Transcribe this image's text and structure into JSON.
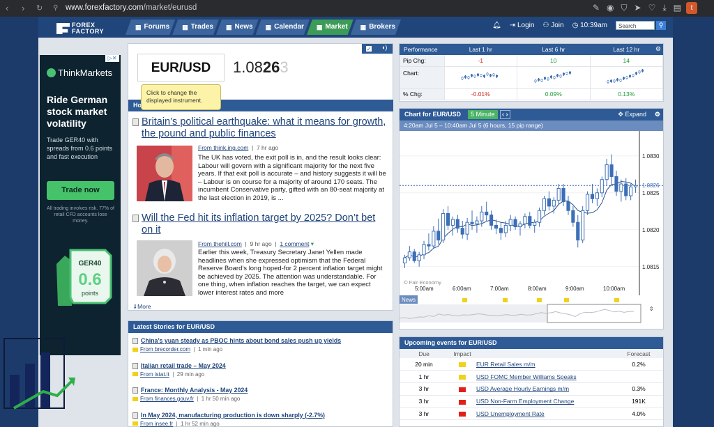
{
  "browser": {
    "url_host": "www.forexfactory.com",
    "url_path": "/market/eurusd",
    "profile_initial": "t"
  },
  "nav": {
    "logo_line1": "FOREX",
    "logo_line2": "FACTORY",
    "tabs": [
      {
        "label": "Forums",
        "icon": "forums-icon"
      },
      {
        "label": "Trades",
        "icon": "trades-icon"
      },
      {
        "label": "News",
        "icon": "news-icon"
      },
      {
        "label": "Calendar",
        "icon": "calendar-icon"
      },
      {
        "label": "Market",
        "icon": "market-icon",
        "active": true
      },
      {
        "label": "Brokers",
        "icon": "brokers-icon"
      }
    ],
    "login": "Login",
    "join": "Join",
    "time": "10:39am",
    "search_placeholder": "Search"
  },
  "ad": {
    "brand": "ThinkMarkets",
    "headline": "Ride German stock market volatility",
    "body": "Trade GER40 with spreads from 0.6 points and fast execution",
    "cta": "Trade now",
    "disclaimer": "All trading involves risk. 77% of retail CFD accounts lose money.",
    "promo_symbol": "GER40",
    "promo_value": "0.6",
    "promo_unit": "points"
  },
  "quote": {
    "pair": "EUR/USD",
    "price_main": "1.08",
    "price_big": "26",
    "price_small": "3",
    "tooltip": "Click to change the displayed instrument."
  },
  "hot_header": "Hottest Stories",
  "stories": [
    {
      "title": "Britain’s political earthquake: what it means for growth, the pound and public finances",
      "source": "From think.ing.com",
      "age": "7 hr ago",
      "body": "The UK has voted, the exit poll is in, and the result looks clear: Labour will govern with a significant majority for the next five years. If that exit poll is accurate – and history suggests it will be – Labour is on course for a majority of around 170 seats. The incumbent Conservative party, gifted with an 80-seat majority at the last election in 2019, is ..."
    },
    {
      "title": "Will the Fed hit its inflation target by 2025? Don’t bet on it",
      "source": "From thehill.com",
      "age": "9 hr ago",
      "comments": "1 comment",
      "body": "Earlier this week, Treasury Secretary Janet Yellen made headlines when she expressed optimism that the Federal Reserve Board’s long hoped-for 2 percent inflation target might be achieved by 2025. The attention was understandable. For one thing, when inflation reaches the target, we can expect lower interest rates and more"
    }
  ],
  "more": "More",
  "latest": {
    "header": "Latest Stories for EUR/USD",
    "items": [
      {
        "title": "China’s yuan steady as PBOC hints about bond sales push up yields",
        "source": "From brecorder.com",
        "age": "1 min ago"
      },
      {
        "title": "Italian retail trade – May 2024",
        "source": "From istat.it",
        "age": "29 min ago"
      },
      {
        "title": "France: Monthly Analysis - May 2024",
        "source": "From finances.gouv.fr",
        "age": "1 hr 50 min ago"
      },
      {
        "title": "In May 2024, manufacturing production is down sharply (-2.7%)",
        "source": "From insee.fr",
        "age": "1 hr 52 min ago"
      }
    ]
  },
  "performance": {
    "header": "Performance",
    "cols": [
      "Last 1 hr",
      "Last 6 hr",
      "Last 12 hr"
    ],
    "row_pip": "Pip Chg:",
    "row_chart": "Chart:",
    "row_pct": "% Chg:",
    "pips": [
      "-1",
      "10",
      "14"
    ],
    "pct": [
      "-0.01%",
      "0.09%",
      "0.13%"
    ],
    "colors": [
      "#c7271f",
      "#1f9b3b",
      "#1f9b3b"
    ]
  },
  "chart": {
    "header": "Chart for EUR/USD",
    "timeframe": "5 Minute",
    "expand": "Expand",
    "subtitle": "4:20am Jul 5 – 10:40am Jul 5 (6 hours, 15 pip range)",
    "source": "© Fair Economy",
    "news_label": "News",
    "current_price": "1.0826"
  },
  "chart_data": {
    "type": "candlestick",
    "x_labels": [
      "5:00am",
      "6:00am",
      "7:00am",
      "8:00am",
      "9:00am",
      "10:00am"
    ],
    "y_ticks": [
      "1.0830",
      "1.0825",
      "1.0820",
      "1.0815"
    ],
    "ylim": [
      1.0813,
      1.0833
    ],
    "ohlc": [
      [
        1.08155,
        1.08166,
        1.08148,
        1.08162
      ],
      [
        1.08162,
        1.08178,
        1.08158,
        1.0817
      ],
      [
        1.0817,
        1.08174,
        1.08155,
        1.08158
      ],
      [
        1.08158,
        1.0817,
        1.0815,
        1.08166
      ],
      [
        1.08166,
        1.08185,
        1.0816,
        1.0818
      ],
      [
        1.0818,
        1.08195,
        1.08172,
        1.08178
      ],
      [
        1.08178,
        1.08205,
        1.08174,
        1.08198
      ],
      [
        1.08198,
        1.08215,
        1.0818,
        1.08186
      ],
      [
        1.08186,
        1.08228,
        1.08182,
        1.08222
      ],
      [
        1.08222,
        1.08232,
        1.082,
        1.08206
      ],
      [
        1.08206,
        1.08218,
        1.08192,
        1.08214
      ],
      [
        1.08214,
        1.0822,
        1.08196,
        1.08202
      ],
      [
        1.08202,
        1.08212,
        1.08188,
        1.08194
      ],
      [
        1.08194,
        1.08216,
        1.08186,
        1.0821
      ],
      [
        1.0821,
        1.08226,
        1.082,
        1.08208
      ],
      [
        1.08208,
        1.08218,
        1.08196,
        1.08212
      ],
      [
        1.08212,
        1.08232,
        1.08204,
        1.08224
      ],
      [
        1.08224,
        1.08238,
        1.08212,
        1.0822
      ],
      [
        1.0822,
        1.08226,
        1.082,
        1.08206
      ],
      [
        1.08206,
        1.08214,
        1.08194,
        1.08202
      ],
      [
        1.08202,
        1.0821,
        1.08186,
        1.08196
      ],
      [
        1.08196,
        1.08212,
        1.0819,
        1.08206
      ],
      [
        1.08206,
        1.0822,
        1.08198,
        1.08214
      ],
      [
        1.08214,
        1.08218,
        1.082,
        1.08204
      ],
      [
        1.08204,
        1.08212,
        1.08192,
        1.08208
      ],
      [
        1.08208,
        1.08222,
        1.08202,
        1.08218
      ],
      [
        1.08218,
        1.08224,
        1.08202,
        1.08206
      ],
      [
        1.08206,
        1.08214,
        1.08196,
        1.0821
      ],
      [
        1.0821,
        1.0823,
        1.08204,
        1.08226
      ],
      [
        1.08226,
        1.08246,
        1.0822,
        1.08242
      ],
      [
        1.08242,
        1.08252,
        1.08226,
        1.08232
      ],
      [
        1.08232,
        1.08244,
        1.08222,
        1.0824
      ],
      [
        1.0824,
        1.08262,
        1.08234,
        1.08256
      ],
      [
        1.08256,
        1.08262,
        1.08232,
        1.08238
      ],
      [
        1.08238,
        1.08246,
        1.0822,
        1.08226
      ],
      [
        1.08226,
        1.08232,
        1.08204,
        1.0821
      ],
      [
        1.0821,
        1.0822,
        1.08176,
        1.08186
      ],
      [
        1.08186,
        1.08232,
        1.08182,
        1.08226
      ],
      [
        1.08226,
        1.08252,
        1.0822,
        1.08248
      ],
      [
        1.08248,
        1.08262,
        1.08236,
        1.08242
      ],
      [
        1.08242,
        1.08256,
        1.08232,
        1.0825
      ],
      [
        1.0825,
        1.08272,
        1.08244,
        1.08268
      ],
      [
        1.08268,
        1.08296,
        1.0826,
        1.08288
      ],
      [
        1.08288,
        1.08302,
        1.08262,
        1.08272
      ],
      [
        1.08272,
        1.0828,
        1.08246,
        1.08252
      ],
      [
        1.08252,
        1.08268,
        1.08238,
        1.08262
      ],
      [
        1.08262,
        1.0827,
        1.0824,
        1.08246
      ],
      [
        1.08246,
        1.08262,
        1.0824,
        1.08258
      ],
      [
        1.08258,
        1.08268,
        1.0825,
        1.0826
      ]
    ]
  },
  "events": {
    "header": "Upcoming events for EUR/USD",
    "cols": [
      "Due",
      "Impact",
      "",
      "Forecast"
    ],
    "rows": [
      {
        "due": "20 min",
        "impact": "#f2d11a",
        "name": "EUR Retail Sales m/m",
        "forecast": "0.2%"
      },
      {
        "due": "1 hr",
        "impact": "#f2d11a",
        "name": "USD FOMC Member Williams Speaks",
        "forecast": ""
      },
      {
        "due": "3 hr",
        "impact": "#e22018",
        "name": "USD Average Hourly Earnings m/m",
        "forecast": "0.3%"
      },
      {
        "due": "3 hr",
        "impact": "#e22018",
        "name": "USD Non-Farm Employment Change",
        "forecast": "191K"
      },
      {
        "due": "3 hr",
        "impact": "#e22018",
        "name": "USD Unemployment Rate",
        "forecast": "4.0%"
      }
    ]
  }
}
